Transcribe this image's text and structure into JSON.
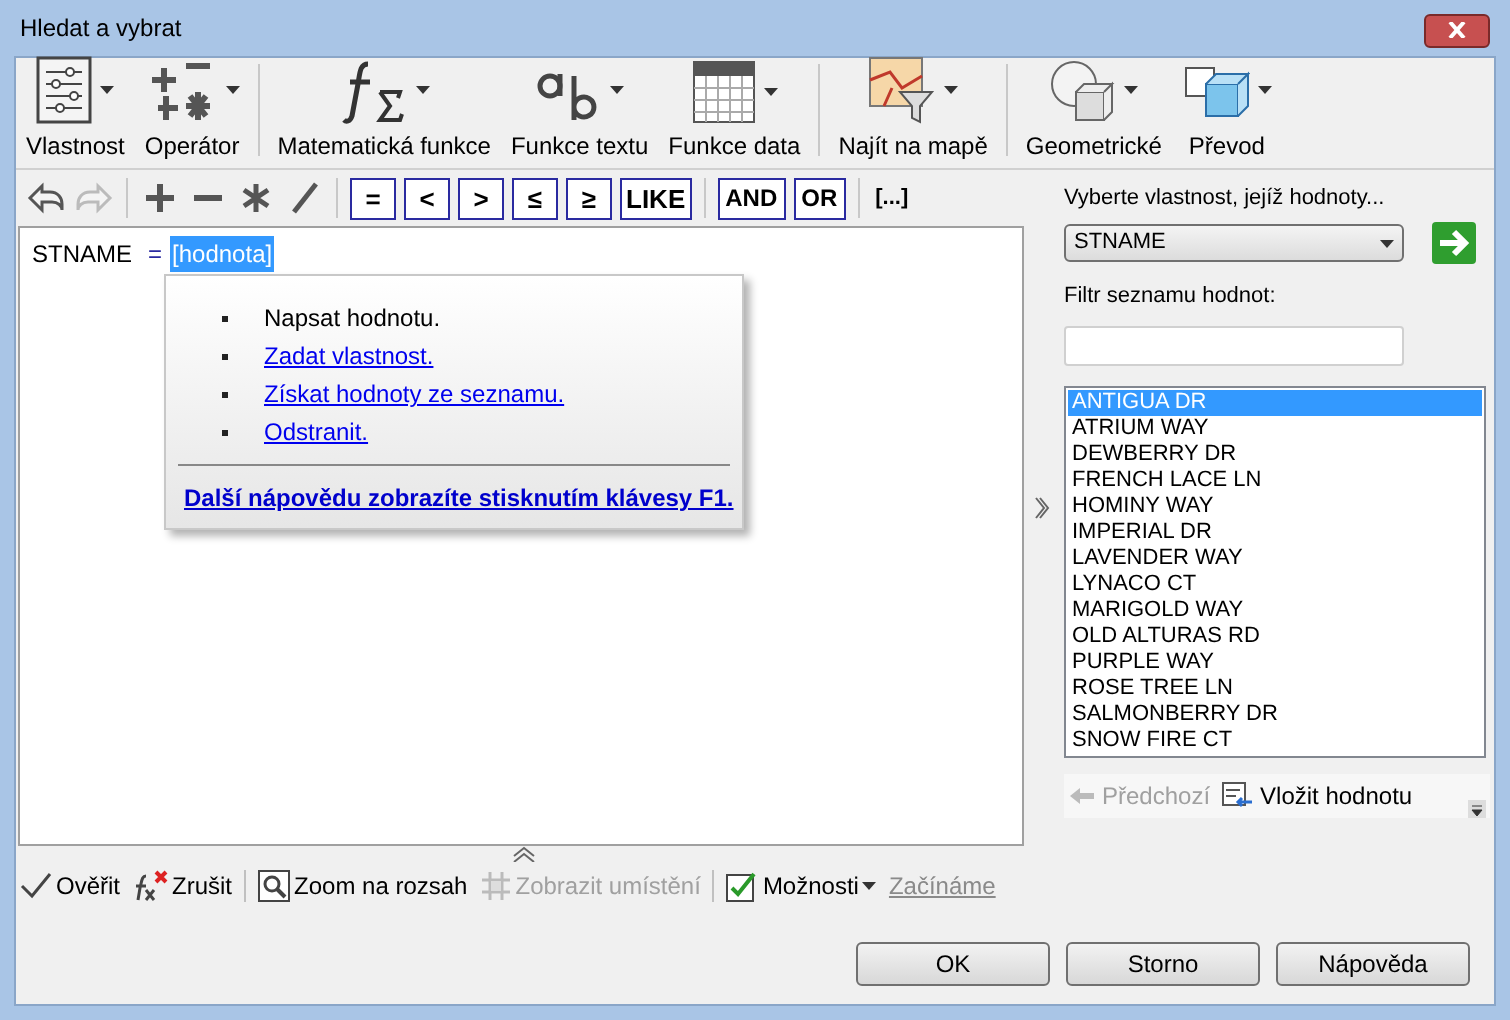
{
  "window": {
    "title": "Hledat a vybrat"
  },
  "ribbon": [
    {
      "kind": "properties",
      "label": "Vlastnost"
    },
    {
      "kind": "operator",
      "label": "Operátor"
    },
    {
      "kind": "math",
      "label": "Matematická funkce"
    },
    {
      "kind": "text",
      "label": "Funkce textu"
    },
    {
      "kind": "date",
      "label": "Funkce data"
    },
    {
      "kind": "map",
      "label": "Najít na mapě"
    },
    {
      "kind": "geometry",
      "label": "Geometrické"
    },
    {
      "kind": "conversion",
      "label": "Převod"
    }
  ],
  "edit_tools": [
    {
      "kind": "undo",
      "disabled": false
    },
    {
      "kind": "redo",
      "disabled": true
    },
    {
      "kind": "plus",
      "disabled": false
    },
    {
      "kind": "minus",
      "disabled": false
    },
    {
      "kind": "multiply",
      "disabled": false
    },
    {
      "kind": "divide",
      "disabled": false
    }
  ],
  "comparison_buttons": [
    "=",
    "<",
    ">",
    "≤",
    "≥",
    "LIKE"
  ],
  "logical_buttons": [
    "AND",
    "OR"
  ],
  "bracket_button": "[...]",
  "expression": {
    "field": "STNAME",
    "operator": "=",
    "value": "[hodnota]",
    "value_selected": true
  },
  "hint_popup": {
    "items": [
      {
        "text": "Napsat hodnotu.",
        "link": false
      },
      {
        "text": "Zadat vlastnost.",
        "link": true
      },
      {
        "text": "Získat hodnoty ze seznamu.",
        "link": true
      },
      {
        "text": "Odstranit.",
        "link": true
      }
    ],
    "help_link": "Další nápovědu zobrazíte stisknutím klávesy F1."
  },
  "value_panel": {
    "prompt": "Vyberte vlastnost, jejíž hodnoty...",
    "property": "STNAME",
    "filter_label": "Filtr seznamu hodnot:",
    "values": [
      {
        "text": "ANTIGUA DR",
        "selected": true
      },
      {
        "text": "ATRIUM WAY",
        "selected": false
      },
      {
        "text": "DEWBERRY DR",
        "selected": false
      },
      {
        "text": "FRENCH LACE LN",
        "selected": false
      },
      {
        "text": "HOMINY WAY",
        "selected": false
      },
      {
        "text": "IMPERIAL DR",
        "selected": false
      },
      {
        "text": "LAVENDER WAY",
        "selected": false
      },
      {
        "text": "LYNACO CT",
        "selected": false
      },
      {
        "text": "MARIGOLD WAY",
        "selected": false
      },
      {
        "text": "OLD ALTURAS RD",
        "selected": false
      },
      {
        "text": "PURPLE WAY",
        "selected": false
      },
      {
        "text": "ROSE TREE LN",
        "selected": false
      },
      {
        "text": "SALMONBERRY DR",
        "selected": false
      },
      {
        "text": "SNOW FIRE CT",
        "selected": false
      }
    ],
    "previous": {
      "label": "Předchozí",
      "disabled": true
    },
    "insert": {
      "label": "Vložit hodnotu",
      "disabled": false
    }
  },
  "bottom_toolbar": [
    {
      "kind": "verify",
      "label": "Ověřit",
      "disabled": false
    },
    {
      "kind": "clear",
      "label": "Zrušit",
      "disabled": false
    },
    {
      "kind": "zoom",
      "label": "Zoom na rozsah",
      "disabled": false
    },
    {
      "kind": "locate",
      "label": "Zobrazit umístění",
      "disabled": true
    },
    {
      "kind": "options",
      "label": "Možnosti",
      "disabled": false
    },
    {
      "kind": "link",
      "label": "Začínáme",
      "disabled": false
    }
  ],
  "buttons": [
    "OK",
    "Storno",
    "Nápověda"
  ]
}
